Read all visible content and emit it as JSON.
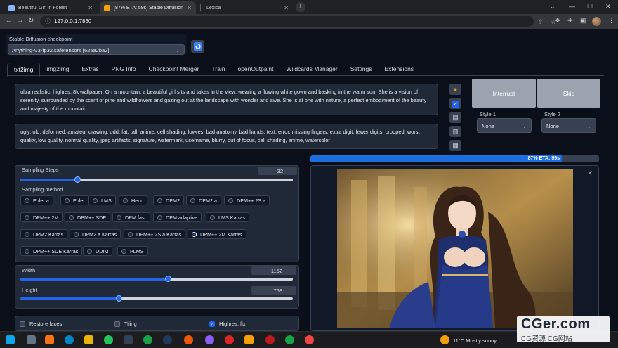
{
  "browser": {
    "tabs": [
      {
        "title": "Beautiful Girl in Forest",
        "favicon_color": "#8ab4f8"
      },
      {
        "title": "[87% ETA: 59s] Stable Diffusion",
        "favicon_color": "#f59e0b"
      },
      {
        "title": "Lexica",
        "favicon_color": "#e5e7eb"
      }
    ],
    "new_tab": "+",
    "url": "127.0.0.1:7860"
  },
  "checkpoint": {
    "label": "Stable Diffusion checkpoint",
    "value": "Anything-V3-fp32.safetensors [625a2ba2]"
  },
  "tabs": [
    "txt2img",
    "img2img",
    "Extras",
    "PNG Info",
    "Checkpoint Merger",
    "Train",
    "openOutpaint",
    "Wildcards Manager",
    "Settings",
    "Extensions"
  ],
  "prompt": {
    "positive": "ultra realistic, highres, 8k wallpaper, On a mountain, a beautiful girl sits and takes in the view, wearing a flowing white gown and basking in the warm sun. She is a vision of serenity, surrounded by the scent of pine and wildflowers and gazing out at the landscape with wonder and awe. She is at one with nature, a perfect embodiment of the beauty and majesty of the mountain",
    "negative": "ugly, old, deformed, amateur drawing, odd, fat, tall, anime, cell shading, lowres, bad anatomy, bad hands, text, error, missing fingers, extra digit, fewer digits, cropped, worst quality, low quality, normal quality, jpeg artifacts, signature, watermark, username, blurry, out of focus, cell shading, anime, watercolor"
  },
  "actions": {
    "interrupt": "Interrupt",
    "skip": "Skip"
  },
  "styles": {
    "style1_label": "Style 1",
    "style1_value": "None",
    "style2_label": "Style 2",
    "style2_value": "None"
  },
  "progress": {
    "text": "87% ETA: 59s",
    "fraction": 0.87
  },
  "sampling": {
    "steps_label": "Sampling Steps",
    "steps_value": "32",
    "steps_fraction": 0.21,
    "method_label": "Sampling method",
    "methods": [
      "Euler a",
      "Euler",
      "LMS",
      "Heun",
      "DPM2",
      "DPM2 a",
      "DPM++ 2S a",
      "DPM++ 2M",
      "DPM++ SDE",
      "DPM fast",
      "DPM adaptive",
      "LMS Karras",
      "DPM2 Karras",
      "DPM2 a Karras",
      "DPM++ 2S a Karras",
      "DPM++ 2M Karras",
      "DPM++ SDE Karras",
      "DDIM",
      "PLMS"
    ],
    "selected": "DPM++ 2M Karras"
  },
  "size": {
    "width_label": "Width",
    "width_value": "1152",
    "width_fraction": 0.54,
    "height_label": "Height",
    "height_value": "768",
    "height_fraction": 0.36
  },
  "options": {
    "restore_faces": "Restore faces",
    "tiling": "Tiling",
    "highres_fix": "Highres. fix"
  },
  "taskbar": {
    "weather": "11°C  Mostly sunny"
  },
  "watermark": {
    "line1": "CGer.com",
    "line2": "CG资源  CG网站"
  }
}
